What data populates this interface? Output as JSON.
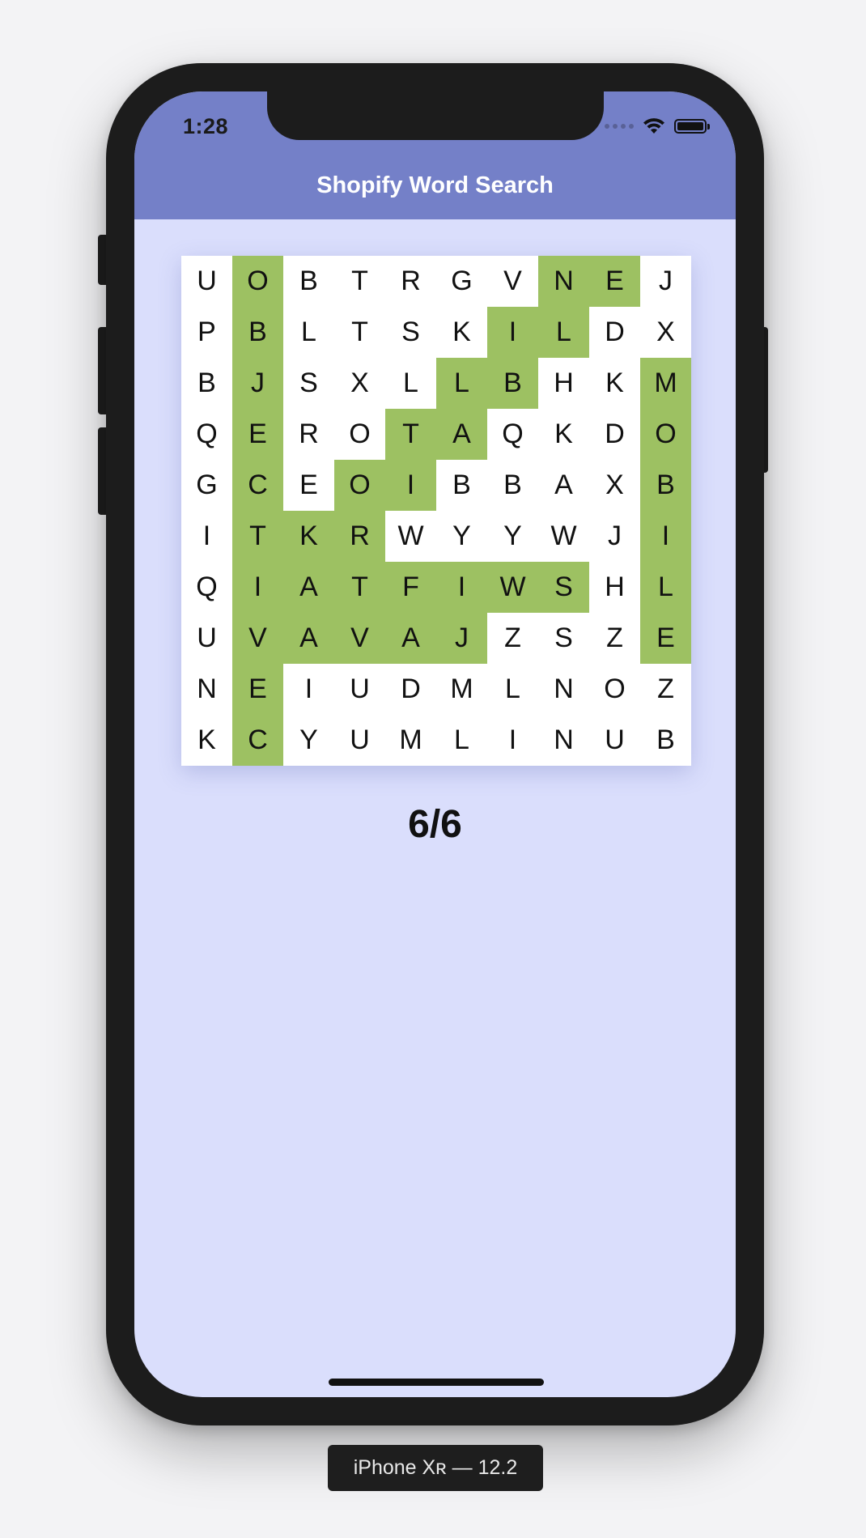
{
  "status_bar": {
    "time": "1:28",
    "icons": [
      "cellular-signal-icon",
      "wifi-icon",
      "battery-icon"
    ]
  },
  "nav": {
    "title": "Shopify Word Search"
  },
  "grid": {
    "rows": [
      [
        "U",
        "O",
        "B",
        "T",
        "R",
        "G",
        "V",
        "N",
        "E",
        "J"
      ],
      [
        "P",
        "B",
        "L",
        "T",
        "S",
        "K",
        "I",
        "L",
        "D",
        "X"
      ],
      [
        "B",
        "J",
        "S",
        "X",
        "L",
        "L",
        "B",
        "H",
        "K",
        "M"
      ],
      [
        "Q",
        "E",
        "R",
        "O",
        "T",
        "A",
        "Q",
        "K",
        "D",
        "O"
      ],
      [
        "G",
        "C",
        "E",
        "O",
        "I",
        "B",
        "B",
        "A",
        "X",
        "B"
      ],
      [
        "I",
        "T",
        "K",
        "R",
        "W",
        "Y",
        "Y",
        "W",
        "J",
        "I"
      ],
      [
        "Q",
        "I",
        "A",
        "T",
        "F",
        "I",
        "W",
        "S",
        "H",
        "L"
      ],
      [
        "U",
        "V",
        "A",
        "V",
        "A",
        "J",
        "Z",
        "S",
        "Z",
        "E"
      ],
      [
        "N",
        "E",
        "I",
        "U",
        "D",
        "M",
        "L",
        "N",
        "O",
        "Z"
      ],
      [
        "K",
        "C",
        "Y",
        "U",
        "M",
        "L",
        "I",
        "N",
        "U",
        "B"
      ]
    ],
    "found": [
      [
        0,
        1,
        0,
        0,
        0,
        0,
        0,
        1,
        1,
        0
      ],
      [
        0,
        1,
        0,
        0,
        0,
        0,
        1,
        1,
        0,
        0
      ],
      [
        0,
        1,
        0,
        0,
        0,
        1,
        1,
        0,
        0,
        1
      ],
      [
        0,
        1,
        0,
        0,
        1,
        1,
        0,
        0,
        0,
        1
      ],
      [
        0,
        1,
        0,
        1,
        1,
        0,
        0,
        0,
        0,
        1
      ],
      [
        0,
        1,
        1,
        1,
        0,
        0,
        0,
        0,
        0,
        1
      ],
      [
        0,
        1,
        1,
        1,
        1,
        1,
        1,
        1,
        0,
        1
      ],
      [
        0,
        1,
        1,
        1,
        1,
        1,
        0,
        0,
        0,
        1
      ],
      [
        0,
        1,
        0,
        0,
        0,
        0,
        0,
        0,
        0,
        0
      ],
      [
        0,
        1,
        0,
        0,
        0,
        0,
        0,
        0,
        0,
        0
      ]
    ],
    "highlight_color": "#9dc162"
  },
  "score": {
    "text": "6/6"
  },
  "device": {
    "label": "iPhone Xʀ — 12.2"
  },
  "colors": {
    "navbar": "#7480c8",
    "background": "#dadefc",
    "found_cell": "#9dc162"
  }
}
